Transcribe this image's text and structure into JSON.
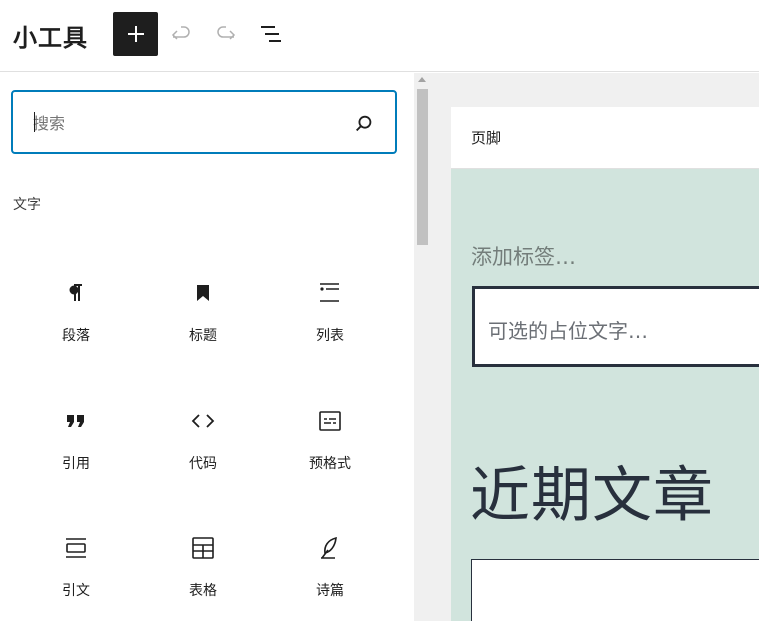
{
  "header": {
    "title": "小工具",
    "add_icon": "plus-icon",
    "undo_icon": "undo-icon",
    "redo_icon": "redo-icon",
    "list_view_icon": "list-view-icon"
  },
  "inserter": {
    "search_placeholder": "搜索",
    "category": "文字",
    "blocks": [
      {
        "label": "段落",
        "icon": "paragraph-icon"
      },
      {
        "label": "标题",
        "icon": "heading-icon"
      },
      {
        "label": "列表",
        "icon": "list-icon"
      },
      {
        "label": "引用",
        "icon": "quote-icon"
      },
      {
        "label": "代码",
        "icon": "code-icon"
      },
      {
        "label": "预格式",
        "icon": "preformatted-icon"
      },
      {
        "label": "引文",
        "icon": "pullquote-icon"
      },
      {
        "label": "表格",
        "icon": "table-icon"
      },
      {
        "label": "诗篇",
        "icon": "verse-icon"
      }
    ]
  },
  "canvas": {
    "area_title": "页脚",
    "search_label": "添加标签…",
    "search_placeholder": "可选的占位文字…",
    "heading": "近期文章",
    "body_bg": "#d1e4dd",
    "text_color": "#28303d"
  }
}
